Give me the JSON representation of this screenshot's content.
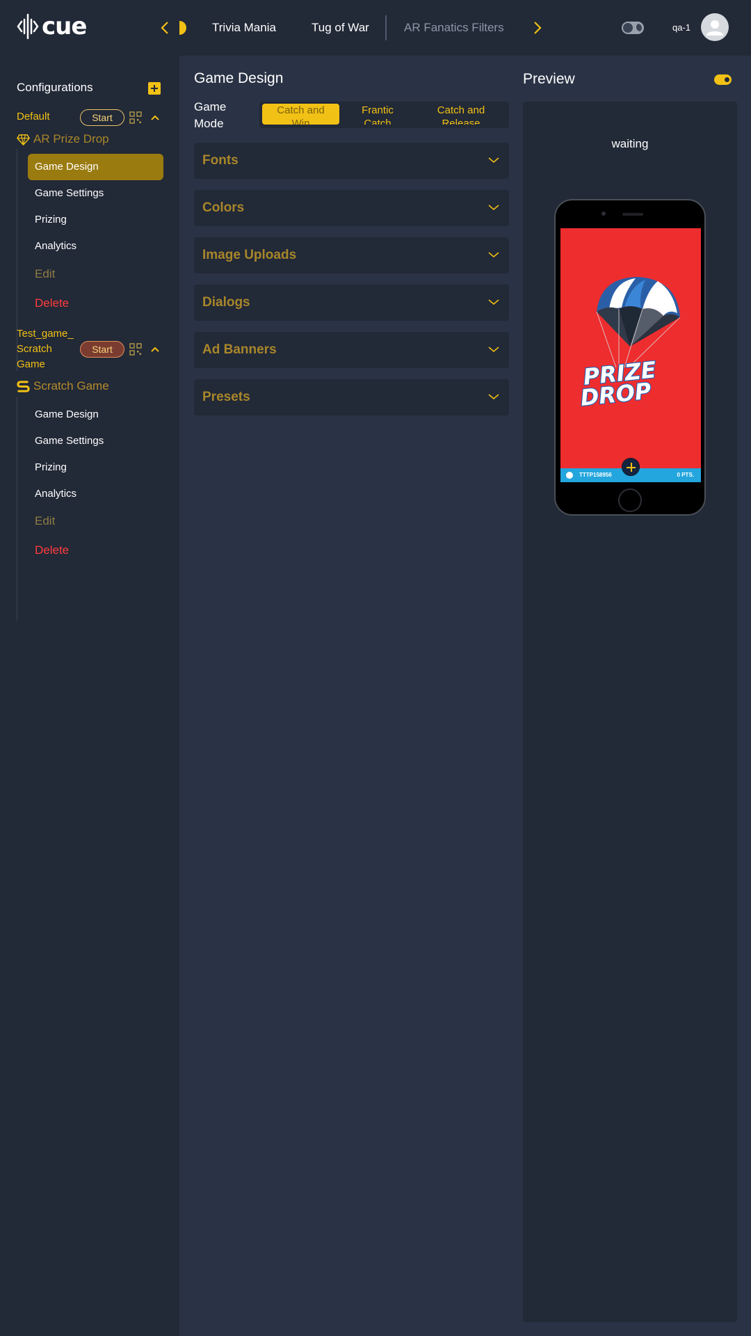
{
  "brand": {
    "logo_text": "cue"
  },
  "header": {
    "tabs": [
      {
        "label": "Trivia Mania"
      },
      {
        "label": "Tug of War"
      },
      {
        "label": "AR Fanatics Filters"
      }
    ],
    "user_name": "qa-1"
  },
  "sidebar": {
    "title": "Configurations",
    "configs": [
      {
        "name": "Default",
        "start_label": "Start",
        "game_type": "AR Prize Drop",
        "menu": [
          "Game Design",
          "Game Settings",
          "Prizing",
          "Analytics"
        ],
        "edit_label": "Edit",
        "delete_label": "Delete",
        "active_item": "Game Design"
      },
      {
        "name_lines": [
          "Test_game_",
          "Scratch",
          "Game"
        ],
        "start_label": "Start",
        "game_type": "Scratch Game",
        "menu": [
          "Game Design",
          "Game Settings",
          "Prizing",
          "Analytics"
        ],
        "edit_label": "Edit",
        "delete_label": "Delete"
      }
    ]
  },
  "main": {
    "title": "Game Design",
    "game_mode_label_lines": [
      "Game",
      "Mode"
    ],
    "game_modes": [
      {
        "lines": [
          "Catch and",
          "Win"
        ],
        "active": true
      },
      {
        "lines": [
          "Frantic",
          "Catch"
        ],
        "active": false
      },
      {
        "lines": [
          "Catch and",
          "Release"
        ],
        "active": false
      }
    ],
    "sections": [
      "Fonts",
      "Colors",
      "Image Uploads",
      "Dialogs",
      "Ad Banners",
      "Presets"
    ]
  },
  "preview": {
    "title": "Preview",
    "status": "waiting",
    "game_logo_lines": [
      "PRIZE",
      "DROP"
    ],
    "bar_code": "TTTP158956",
    "bar_points": "0 PTS."
  },
  "colors": {
    "accent": "#f2c115",
    "header_bg": "#222937",
    "main_bg": "#2a3345",
    "danger": "#ff3d3d",
    "phone_screen": "#ee2d2f",
    "game_bar": "#23a6de"
  },
  "icons": [
    "back-chevron-icon",
    "forward-chevron-icon",
    "theme-toggle-icon",
    "user-avatar-icon",
    "add-icon",
    "qr-code-icon",
    "collapse-caret-icon",
    "diamond-icon",
    "scratch-s-icon",
    "expand-chevron-icon"
  ]
}
